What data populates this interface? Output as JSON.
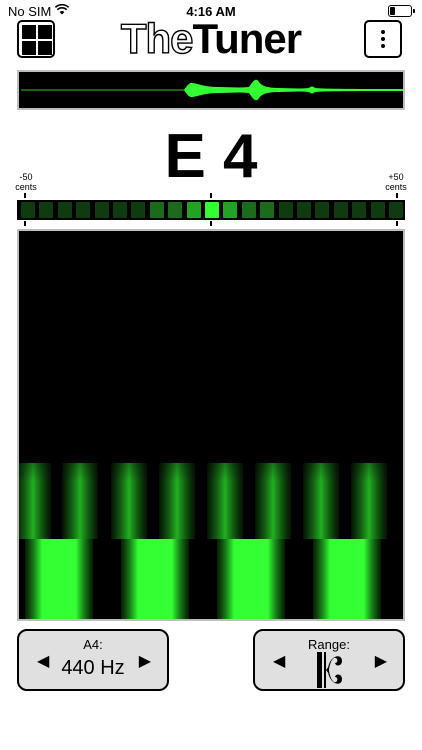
{
  "status_bar": {
    "carrier": "No SIM",
    "time": "4:16 AM",
    "battery_level": 0.25
  },
  "header": {
    "title_light": "The",
    "title_bold": "Tuner",
    "menu_icon": "grid-icon",
    "more_icon": "vertical-ellipsis-icon"
  },
  "note": {
    "name": "E 4"
  },
  "cents": {
    "left_label": "-50\ncents",
    "right_label": "+50\ncents",
    "segments": 21,
    "active_segment": 10,
    "colors": {
      "off": "#103a10",
      "dim": "#1c6b1c",
      "mid": "#23a323",
      "bright": "#33ff33"
    }
  },
  "a4_control": {
    "label": "A4:",
    "value": "440 Hz",
    "left_icon": "triangle-left-icon",
    "right_icon": "triangle-right-icon"
  },
  "range_control": {
    "label": "Range:",
    "value_icon": "c-clef-icon",
    "left_icon": "triangle-left-icon",
    "right_icon": "triangle-right-icon"
  },
  "colors": {
    "accent": "#33ff33",
    "panel": "#e0e0e0",
    "display_bg": "#000000",
    "display_border": "#bdbdbd"
  }
}
